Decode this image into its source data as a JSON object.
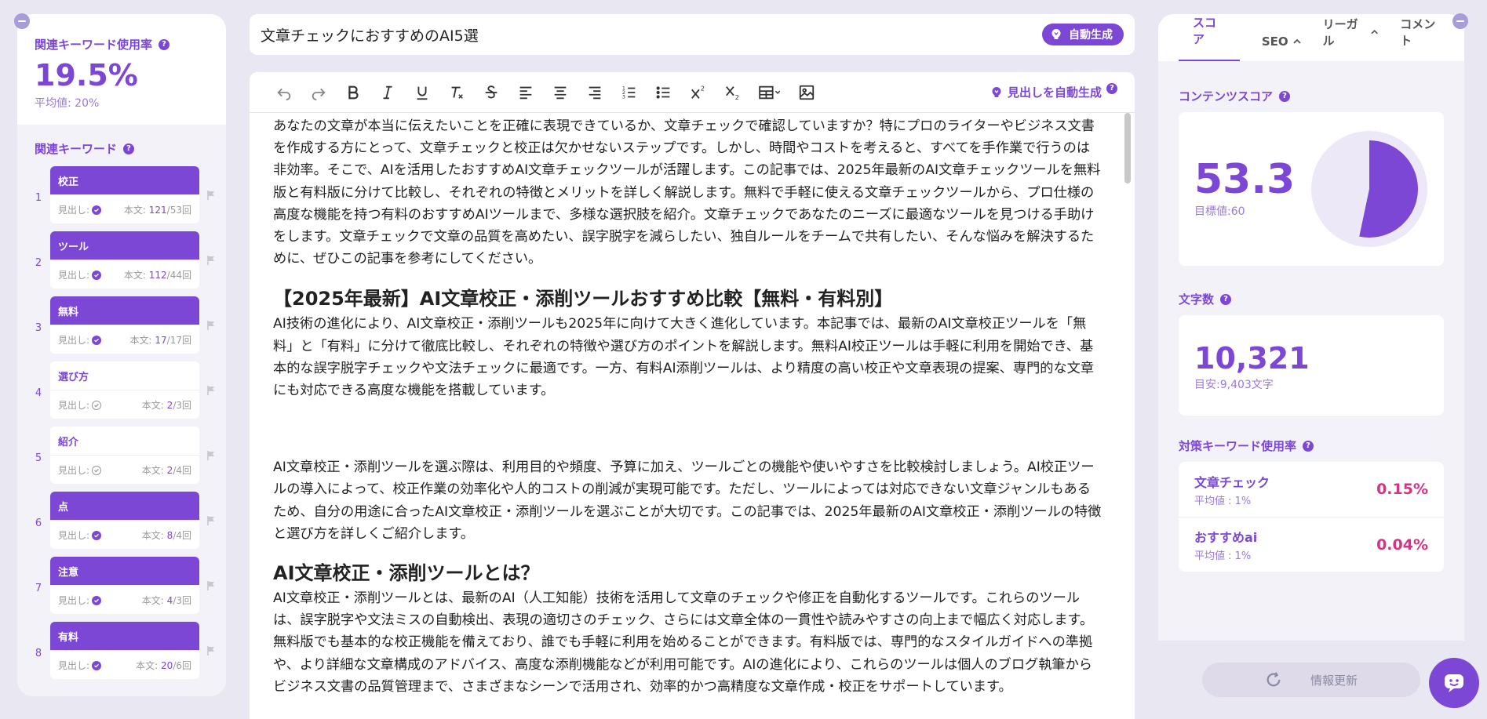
{
  "left_panel": {
    "usage_title": "関連キーワード使用率",
    "usage_value": "19.5%",
    "usage_avg": "平均値: 20%",
    "keywords_title": "関連キーワード",
    "keywords": [
      {
        "num": "1",
        "name": "校正",
        "heading_label": "見出し:",
        "heading_used": true,
        "body_label": "本文:",
        "body_count": "121",
        "body_target": "/53回"
      },
      {
        "num": "2",
        "name": "ツール",
        "heading_label": "見出し:",
        "heading_used": true,
        "body_label": "本文:",
        "body_count": "112",
        "body_target": "/44回"
      },
      {
        "num": "3",
        "name": "無料",
        "heading_label": "見出し:",
        "heading_used": true,
        "body_label": "本文:",
        "body_count": "17",
        "body_target": "/17回"
      },
      {
        "num": "4",
        "name": "選び方",
        "heading_label": "見出し:",
        "heading_used": false,
        "body_label": "本文:",
        "body_count": "2",
        "body_target": "/3回"
      },
      {
        "num": "5",
        "name": "紹介",
        "heading_label": "見出し:",
        "heading_used": false,
        "body_label": "本文:",
        "body_count": "2",
        "body_target": "/4回"
      },
      {
        "num": "6",
        "name": "点",
        "heading_label": "見出し:",
        "heading_used": true,
        "body_label": "本文:",
        "body_count": "8",
        "body_target": "/4回"
      },
      {
        "num": "7",
        "name": "注意",
        "heading_label": "見出し:",
        "heading_used": true,
        "body_label": "本文:",
        "body_count": "4",
        "body_target": "/3回"
      },
      {
        "num": "8",
        "name": "有料",
        "heading_label": "見出し:",
        "heading_used": true,
        "body_label": "本文:",
        "body_count": "20",
        "body_target": "/6回"
      }
    ]
  },
  "editor": {
    "title": "文章チェックにおすすめのAI5選",
    "auto_generate_label": "自動生成",
    "auto_heading_label": "見出しを自動生成",
    "intro": "あなたの文章が本当に伝えたいことを正確に表現できているか、文章チェックで確認していますか？特にプロのライターやビジネス文書を作成する方にとって、文章チェックと校正は欠かせないステップです。しかし、時間やコストを考えると、すべてを手作業で行うのは非効率。そこで、AIを活用したおすすめAI文章チェックツールが活躍します。この記事では、2025年最新のAI文章チェックツールを無料版と有料版に分けて比較し、それぞれの特徴とメリットを詳しく解説します。無料で手軽に使える文章チェックツールから、プロ仕様の高度な機能を持つ有料のおすすめAIツールまで、多様な選択肢を紹介。文章チェックであなたのニーズに最適なツールを見つける手助けをします。文章チェックで文章の品質を高めたい、誤字脱字を減らしたい、独自ルールをチームで共有したい、そんな悩みを解決するために、ぜひこの記事を参考にしてください。",
    "h2_1": "【2025年最新】AI文章校正・添削ツールおすすめ比較【無料・有料別】",
    "p1": "AI技術の進化により、AI文章校正・添削ツールも2025年に向けて大きく進化しています。本記事では、最新のAI文章校正ツールを「無料」と「有料」に分けて徹底比較し、それぞれの特徴や選び方のポイントを解説します。無料AI校正ツールは手軽に利用を開始でき、基本的な誤字脱字チェックや文法チェックに最適です。一方、有料AI添削ツールは、より精度の高い校正や文章表現の提案、専門的な文章にも対応できる高度な機能を搭載しています。",
    "p2": "AI文章校正・添削ツールを選ぶ際は、利用目的や頻度、予算に加え、ツールごとの機能や使いやすさを比較検討しましょう。AI校正ツールの導入によって、校正作業の効率化や人的コストの削減が実現可能です。ただし、ツールによっては対応できない文章ジャンルもあるため、自分の用途に合ったAI文章校正・添削ツールを選ぶことが大切です。この記事では、2025年最新のAI文章校正・添削ツールの特徴と選び方を詳しくご紹介します。",
    "h2_2": "AI文章校正・添削ツールとは？",
    "p3": "AI文章校正・添削ツールとは、最新のAI（人工知能）技術を活用して文章のチェックや修正を自動化するツールです。これらのツールは、誤字脱字や文法ミスの自動検出、表現の適切さのチェック、さらには文章全体の一貫性や読みやすさの向上まで幅広く対応します。無料版でも基本的な校正機能を備えており、誰でも手軽に利用を始めることができます。有料版では、専門的なスタイルガイドへの準拠や、より詳細な文章構成のアドバイス、高度な添削機能などが利用可能です。AIの進化により、これらのツールは個人のブログ執筆からビジネス文書の品質管理まで、さまざまなシーンで活用され、効率的かつ高精度な文章作成・校正をサポートしています。"
  },
  "right_panel": {
    "tabs": [
      "スコア",
      "SEO",
      "リーガル",
      "コメント"
    ],
    "content_score_title": "コンテンツスコア",
    "content_score": "53.3",
    "content_score_value": 53.3,
    "content_goal": "目標値:60",
    "char_count_title": "文字数",
    "char_count": "10,321",
    "char_target": "目安:9,403文字",
    "target_kw_title": "対策キーワード使用率",
    "target_keywords": [
      {
        "name": "文章チェック",
        "avg": "平均値 : 1%",
        "pct": "0.15%"
      },
      {
        "name": "おすすめai",
        "avg": "平均値 : 1%",
        "pct": "0.04%"
      }
    ],
    "refresh_label": "情報更新"
  },
  "colors": {
    "accent": "#7d47d6",
    "accent_light": "#9b79db",
    "pink": "#d63384",
    "bg": "#e9e8f2"
  },
  "icons": [
    "undo-icon",
    "redo-icon",
    "bold-icon",
    "italic-icon",
    "underline-icon",
    "clear-format-icon",
    "strikethrough-icon",
    "align-left-icon",
    "align-center-icon",
    "align-right-icon",
    "ordered-list-icon",
    "bullet-list-icon",
    "superscript-icon",
    "subscript-icon",
    "table-icon",
    "image-icon",
    "bulb-icon",
    "flag-icon",
    "refresh-icon",
    "chat-icon",
    "help-icon"
  ]
}
